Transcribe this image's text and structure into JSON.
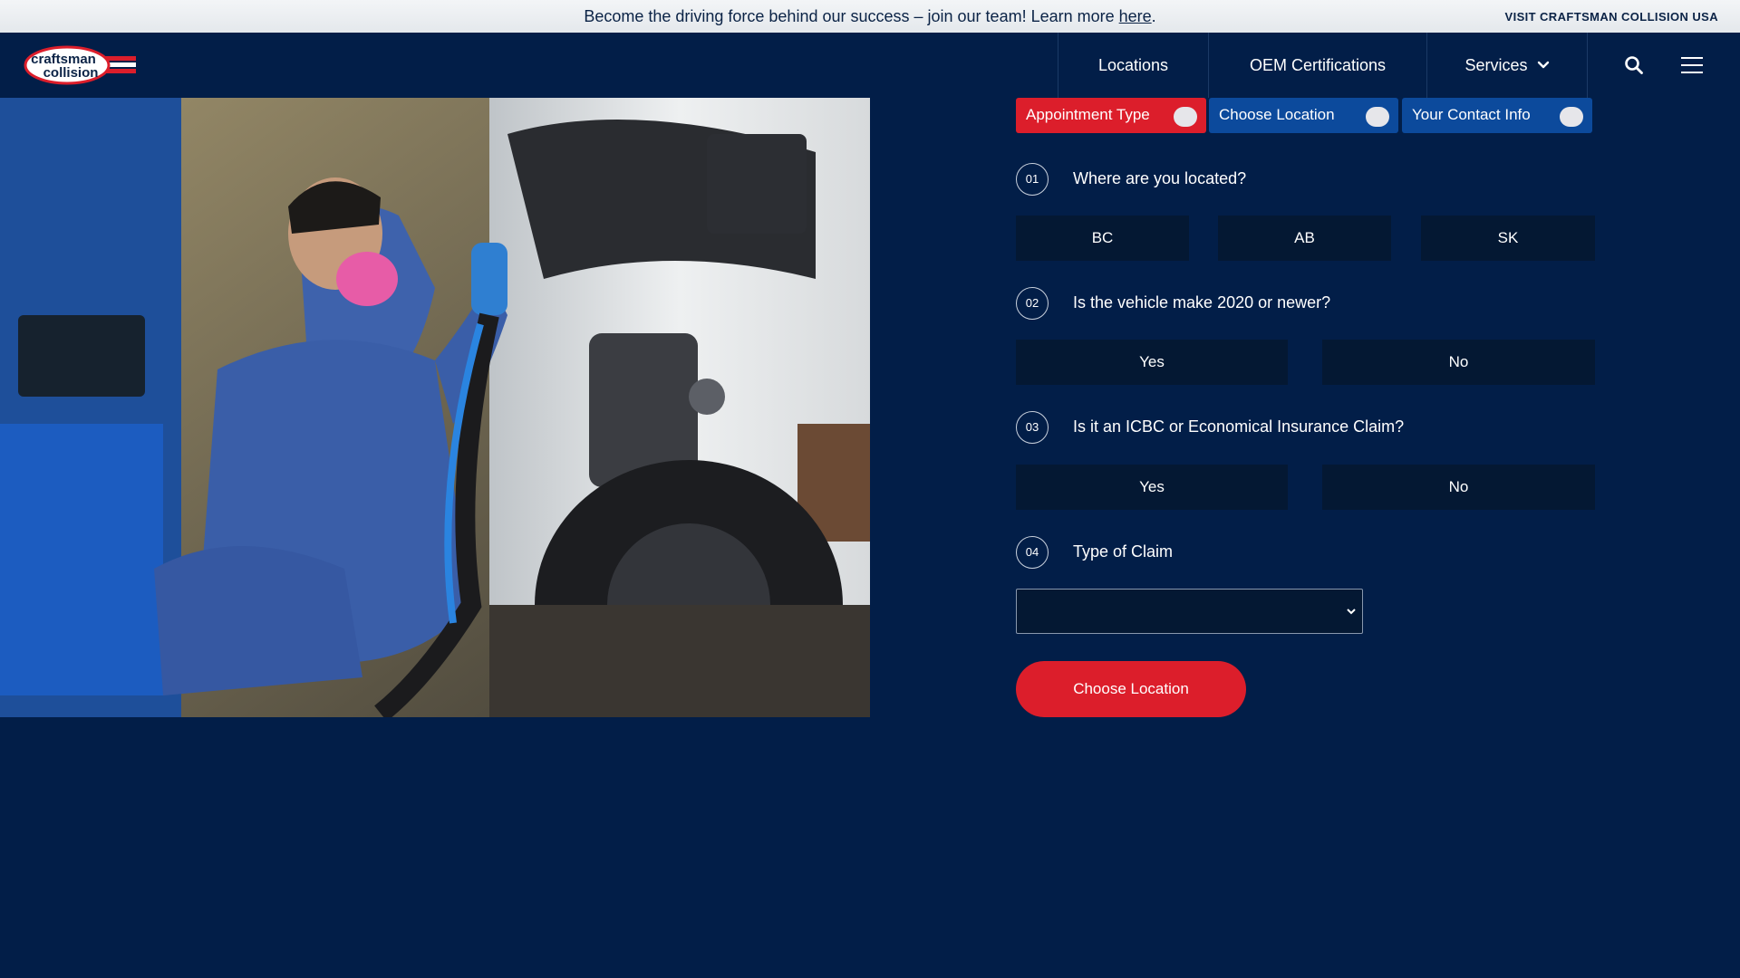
{
  "announcement": {
    "message": "Become the driving force behind our success – join our team! Learn more ",
    "link": "here",
    "suffix": ".",
    "usa_link": "VISIT CRAFTSMAN COLLISION USA"
  },
  "header": {
    "logo_top": "craftsman",
    "logo_bottom": "collision",
    "nav": [
      {
        "label": "Locations"
      },
      {
        "label": "OEM Certifications"
      },
      {
        "label": "Services"
      }
    ]
  },
  "steps": [
    {
      "label": "Appointment Type",
      "color": "#dc1e2b"
    },
    {
      "label": "Choose Location",
      "color": "#0c4a9c"
    },
    {
      "label": "Your Contact Info",
      "color": "#0c4a9c"
    }
  ],
  "questions": [
    {
      "num": "01",
      "text": "Where are you located?",
      "options": [
        "BC",
        "AB",
        "SK"
      ]
    },
    {
      "num": "02",
      "text": "Is the vehicle make 2020 or newer?",
      "options": [
        "Yes",
        "No"
      ]
    },
    {
      "num": "03",
      "text": "Is it an ICBC or Economical Insurance Claim?",
      "options": [
        "Yes",
        "No"
      ]
    },
    {
      "num": "04",
      "text": "Type of Claim"
    }
  ],
  "claim_select": {
    "value": ""
  },
  "cta_label": "Choose Location",
  "icons": {
    "search": "search-icon",
    "menu": "hamburger-menu-icon",
    "services_chevron": "chevron-down-icon",
    "select_chevron": "chevron-down-icon"
  },
  "colors": {
    "background": "#021e48",
    "accent_red": "#dc1e2b",
    "step_blue": "#0c4a9c",
    "option_bg": "#041833"
  }
}
